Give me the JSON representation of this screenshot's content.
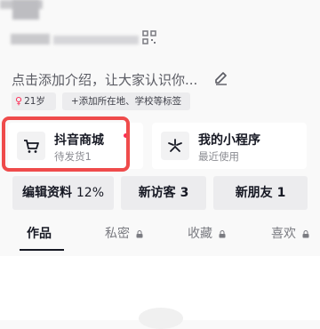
{
  "profile": {
    "intro_text": "点击添加介绍，让大家认识你...",
    "age_tag": "21岁",
    "age_symbol": "♀",
    "add_tag": "+添加所在地、学校等标签"
  },
  "services": {
    "mall": {
      "title": "抖音商城",
      "subtitle": "待发货1",
      "icon": "shopping-cart-icon",
      "has_dot": true
    },
    "mini": {
      "title": "我的小程序",
      "subtitle": "最近使用",
      "icon": "asterisk-icon"
    }
  },
  "actions": {
    "edit_label": "编辑资料",
    "edit_percent": "12%",
    "visitors_label": "新访客",
    "visitors_count": "3",
    "friends_label": "新朋友",
    "friends_count": "1"
  },
  "tabs": [
    {
      "label": "作品",
      "active": true,
      "locked": false
    },
    {
      "label": "私密",
      "active": false,
      "locked": true
    },
    {
      "label": "收藏",
      "active": false,
      "locked": true
    },
    {
      "label": "喜欢",
      "active": false,
      "locked": true
    }
  ],
  "colors": {
    "accent": "#fe2c55",
    "highlight": "#ef4b4b"
  }
}
